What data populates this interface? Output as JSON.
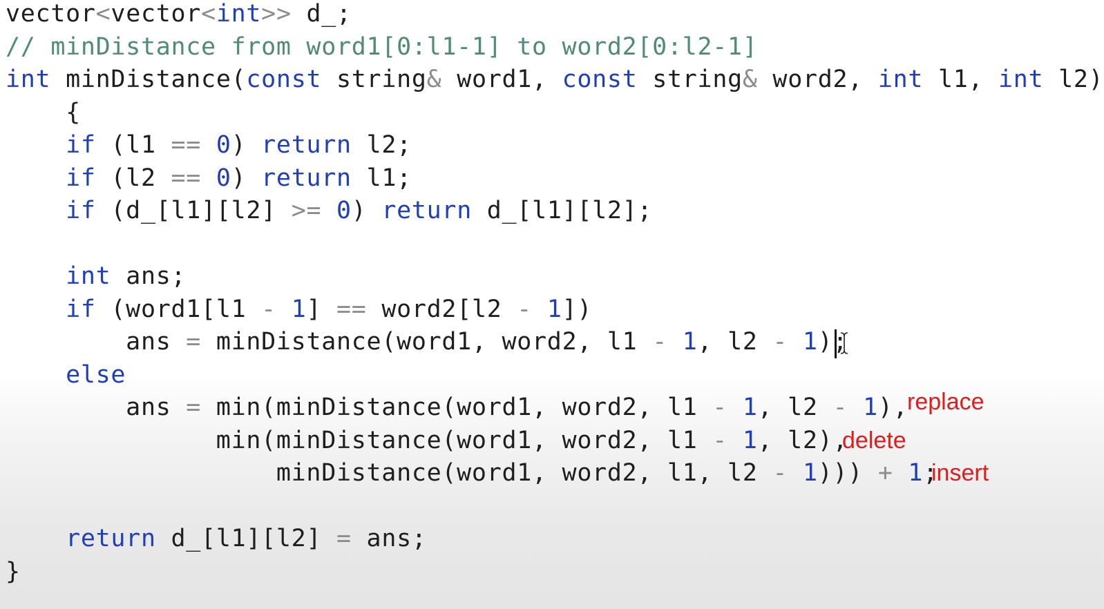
{
  "code": {
    "lines": [
      [
        [
          "vector",
          "plain"
        ],
        [
          "<",
          "op"
        ],
        [
          "vector",
          "plain"
        ],
        [
          "<",
          "op"
        ],
        [
          "int",
          "kw"
        ],
        [
          ">>",
          "op"
        ],
        [
          " d_;",
          "plain"
        ]
      ],
      [
        [
          "// minDistance from word1[0:l1-1] to word2[0:l2-1]",
          "cm"
        ]
      ],
      [
        [
          "int",
          "kw"
        ],
        [
          " minDistance(",
          "plain"
        ],
        [
          "const",
          "kw"
        ],
        [
          " string",
          "plain"
        ],
        [
          "&",
          "op"
        ],
        [
          " word1, ",
          "plain"
        ],
        [
          "const",
          "kw"
        ],
        [
          " string",
          "plain"
        ],
        [
          "&",
          "op"
        ],
        [
          " word2, ",
          "plain"
        ],
        [
          "int",
          "kw"
        ],
        [
          " l1, ",
          "plain"
        ],
        [
          "int",
          "kw"
        ],
        [
          " l2)",
          "plain"
        ]
      ],
      [
        [
          "    {",
          "plain"
        ]
      ],
      [
        [
          "    ",
          "plain"
        ],
        [
          "if",
          "kw"
        ],
        [
          " (l1 ",
          "plain"
        ],
        [
          "==",
          "op"
        ],
        [
          " ",
          "plain"
        ],
        [
          "0",
          "num"
        ],
        [
          ") ",
          "plain"
        ],
        [
          "return",
          "kw"
        ],
        [
          " l2;",
          "plain"
        ]
      ],
      [
        [
          "    ",
          "plain"
        ],
        [
          "if",
          "kw"
        ],
        [
          " (l2 ",
          "plain"
        ],
        [
          "==",
          "op"
        ],
        [
          " ",
          "plain"
        ],
        [
          "0",
          "num"
        ],
        [
          ") ",
          "plain"
        ],
        [
          "return",
          "kw"
        ],
        [
          " l1;",
          "plain"
        ]
      ],
      [
        [
          "    ",
          "plain"
        ],
        [
          "if",
          "kw"
        ],
        [
          " (d_[l1][l2] ",
          "plain"
        ],
        [
          ">=",
          "op"
        ],
        [
          " ",
          "plain"
        ],
        [
          "0",
          "num"
        ],
        [
          ") ",
          "plain"
        ],
        [
          "return",
          "kw"
        ],
        [
          " d_[l1][l2];",
          "plain"
        ]
      ],
      [],
      [
        [
          "    ",
          "plain"
        ],
        [
          "int",
          "kw"
        ],
        [
          " ans;",
          "plain"
        ]
      ],
      [
        [
          "    ",
          "plain"
        ],
        [
          "if",
          "kw"
        ],
        [
          " (word1[l1 ",
          "plain"
        ],
        [
          "-",
          "op"
        ],
        [
          " ",
          "plain"
        ],
        [
          "1",
          "num"
        ],
        [
          "] ",
          "plain"
        ],
        [
          "==",
          "op"
        ],
        [
          " word2[l2 ",
          "plain"
        ],
        [
          "-",
          "op"
        ],
        [
          " ",
          "plain"
        ],
        [
          "1",
          "num"
        ],
        [
          "])",
          "plain"
        ]
      ],
      [
        [
          "        ans ",
          "plain"
        ],
        [
          "=",
          "op"
        ],
        [
          " minDistance(word1, word2, l1 ",
          "plain"
        ],
        [
          "-",
          "op"
        ],
        [
          " ",
          "plain"
        ],
        [
          "1",
          "num"
        ],
        [
          ", l2 ",
          "plain"
        ],
        [
          "-",
          "op"
        ],
        [
          " ",
          "plain"
        ],
        [
          "1",
          "num"
        ],
        [
          ");",
          "plain"
        ]
      ],
      [
        [
          "    ",
          "plain"
        ],
        [
          "else",
          "kw"
        ]
      ],
      [
        [
          "        ans ",
          "plain"
        ],
        [
          "=",
          "op"
        ],
        [
          " min(minDistance(word1, word2, l1 ",
          "plain"
        ],
        [
          "-",
          "op"
        ],
        [
          " ",
          "plain"
        ],
        [
          "1",
          "num"
        ],
        [
          ", l2 ",
          "plain"
        ],
        [
          "-",
          "op"
        ],
        [
          " ",
          "plain"
        ],
        [
          "1",
          "num"
        ],
        [
          "),",
          "plain"
        ]
      ],
      [
        [
          "              min(minDistance(word1, word2, l1 ",
          "plain"
        ],
        [
          "-",
          "op"
        ],
        [
          " ",
          "plain"
        ],
        [
          "1",
          "num"
        ],
        [
          ", l2),",
          "plain"
        ]
      ],
      [
        [
          "                  minDistance(word1, word2, l1, l2 ",
          "plain"
        ],
        [
          "-",
          "op"
        ],
        [
          " ",
          "plain"
        ],
        [
          "1",
          "num"
        ],
        [
          "))) ",
          "plain"
        ],
        [
          "+",
          "op"
        ],
        [
          " ",
          "plain"
        ],
        [
          "1",
          "num"
        ],
        [
          ";",
          "plain"
        ]
      ],
      [],
      [
        [
          "    ",
          "plain"
        ],
        [
          "return",
          "kw"
        ],
        [
          " d_[l1][l2] ",
          "plain"
        ],
        [
          "=",
          "op"
        ],
        [
          " ans;",
          "plain"
        ]
      ],
      [
        [
          "}",
          "plain"
        ]
      ]
    ]
  },
  "annotations": {
    "replace": "replace",
    "delete": "delete",
    "insert": "insert"
  },
  "colors": {
    "keyword": "#1f3fb8",
    "operator": "#8c8c8c",
    "comment": "#4e8c74",
    "text": "#1e1e1e",
    "annotation": "#e21b1b"
  }
}
